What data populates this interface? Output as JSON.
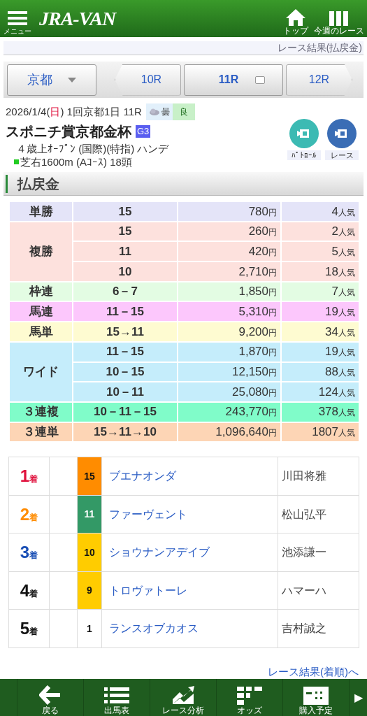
{
  "header": {
    "menu_label": "メニュー",
    "logo": "JRA-VAN",
    "nav": [
      {
        "kind": "home",
        "label": "トップ"
      },
      {
        "kind": "columns",
        "label": "今週のレース"
      }
    ]
  },
  "breadcrumb": "レース結果(払戻金)",
  "venue_select": "京都",
  "race_tabs": [
    {
      "kind": "prev",
      "label": "10R",
      "selected": false
    },
    {
      "kind": "current",
      "label": "11R",
      "selected": true
    },
    {
      "kind": "next",
      "label": "12R",
      "selected": false
    }
  ],
  "race_info": {
    "date_prefix": "2026/1/4(",
    "weekday": "日",
    "date_suffix": ") 1回京都1日 11R",
    "weather": "曇",
    "going": "良",
    "title": "スポニチ賞京都金杯",
    "grade": "G3",
    "conditions": "４歳上ｵｰﾌﾟﾝ (国際)(特指) ハンデ",
    "course": "芝右1600m (Aｺｰｽ) 18頭"
  },
  "video_buttons": [
    {
      "label": "ﾊﾟﾄﾛｰﾙ",
      "color": "#3cbab3"
    },
    {
      "label": "レース",
      "color": "#3a6db5"
    }
  ],
  "section_title": "払戻金",
  "payouts": [
    {
      "bet_type": "単勝",
      "color": "#e4e4f8",
      "rows": [
        {
          "combination": "15",
          "payout": "780円",
          "popularity": "4人気"
        }
      ]
    },
    {
      "bet_type": "複勝",
      "color": "#fde1dd",
      "rows": [
        {
          "combination": "15",
          "payout": "260円",
          "popularity": "2人気"
        },
        {
          "combination": "11",
          "payout": "420円",
          "popularity": "5人気"
        },
        {
          "combination": "10",
          "payout": "2,710円",
          "popularity": "18人気"
        }
      ]
    },
    {
      "bet_type": "枠連",
      "color": "#e3fce3",
      "rows": [
        {
          "combination": "6－7",
          "payout": "1,850円",
          "popularity": "7人気"
        }
      ]
    },
    {
      "bet_type": "馬連",
      "color": "#fcc7fc",
      "rows": [
        {
          "combination": "11－15",
          "payout": "5,310円",
          "popularity": "19人気"
        }
      ]
    },
    {
      "bet_type": "馬単",
      "color": "#fefbd1",
      "rows": [
        {
          "combination": "15→11",
          "payout": "9,200円",
          "popularity": "34人気"
        }
      ]
    },
    {
      "bet_type": "ワイド",
      "color": "#c5edfb",
      "rows": [
        {
          "combination": "11－15",
          "payout": "1,870円",
          "popularity": "19人気"
        },
        {
          "combination": "10－15",
          "payout": "12,150円",
          "popularity": "88人気"
        },
        {
          "combination": "10－11",
          "payout": "25,080円",
          "popularity": "124人気"
        }
      ]
    },
    {
      "bet_type": "３連複",
      "color": "#80fcc9",
      "rows": [
        {
          "combination": "10－11－15",
          "payout": "243,770円",
          "popularity": "378人気"
        }
      ]
    },
    {
      "bet_type": "３連単",
      "color": "#fdd5b5",
      "rows": [
        {
          "combination": "15→11→10",
          "payout": "1,096,640円",
          "popularity": "1807人気"
        }
      ]
    }
  ],
  "results": [
    {
      "place": "1着",
      "color": "#e0103c",
      "number": {
        "label": "15",
        "color": "#ff8c00"
      },
      "horse": "ブエナオンダ",
      "jockey": "川田将雅"
    },
    {
      "place": "2着",
      "color": "#ff8c00",
      "number": {
        "label": "11",
        "color": "#339966"
      },
      "horse": "ファーヴェント",
      "jockey": "松山弘平"
    },
    {
      "place": "3着",
      "color": "#1a4fb5",
      "number": {
        "label": "10",
        "color": "#ffcc00"
      },
      "horse": "ショウナンアデイブ",
      "jockey": "池添謙一"
    },
    {
      "place": "4着",
      "color": "#111111",
      "number": {
        "label": "9",
        "color": "#ffcc00"
      },
      "horse": "トロヴァトーレ",
      "jockey": "ハマーハ"
    },
    {
      "place": "5着",
      "color": "#111111",
      "number": {
        "label": "1",
        "color": "#ffffff"
      },
      "horse": "ランスオブカオス",
      "jockey": "吉村誠之"
    }
  ],
  "results_link": "レース結果(着順)へ",
  "bottom_nav": [
    {
      "kind": "back",
      "label": "戻る"
    },
    {
      "kind": "list",
      "label": "出馬表"
    },
    {
      "kind": "chart",
      "label": "レース分析"
    },
    {
      "kind": "odds",
      "label": "オッズ"
    },
    {
      "kind": "ticket",
      "label": "購入予定"
    }
  ],
  "bottom_nav_more": "▶"
}
